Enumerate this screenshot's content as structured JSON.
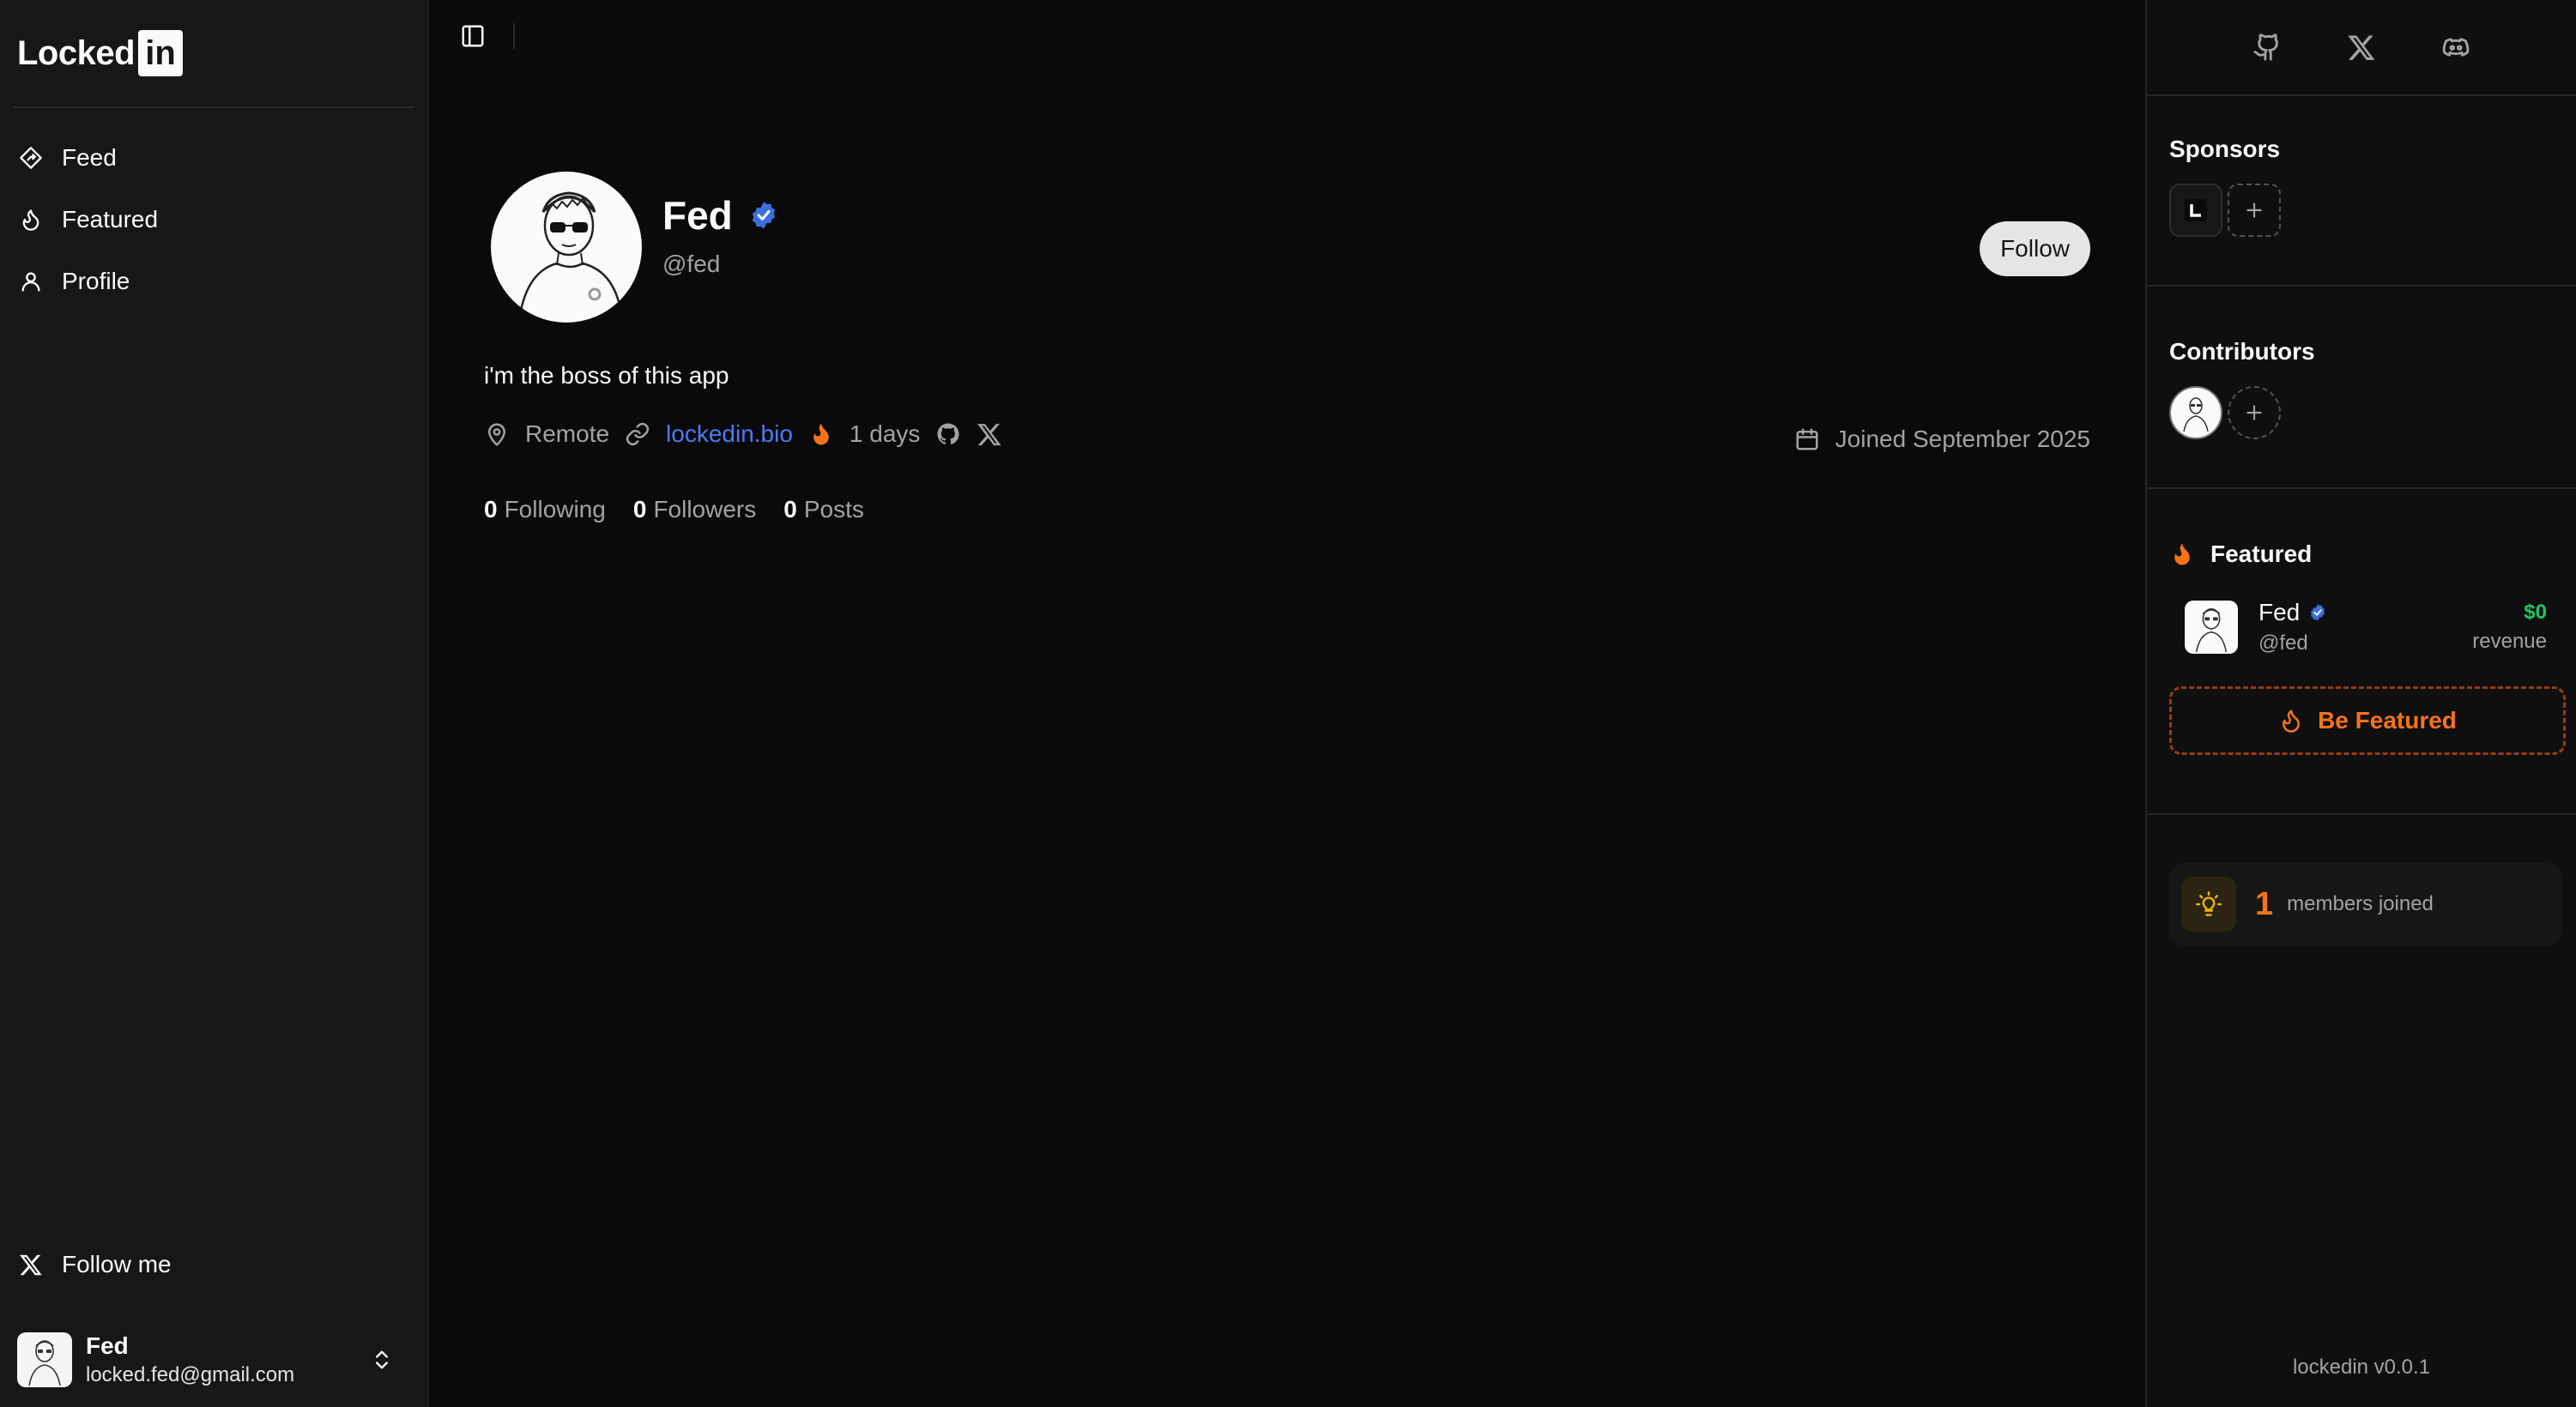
{
  "brand": {
    "text": "Locked",
    "box": "in"
  },
  "nav": {
    "items": [
      {
        "label": "Feed",
        "icon": "feed-icon"
      },
      {
        "label": "Featured",
        "icon": "flame-icon"
      },
      {
        "label": "Profile",
        "icon": "user-icon"
      }
    ],
    "follow_me": "Follow me"
  },
  "current_user": {
    "name": "Fed",
    "email": "locked.fed@gmail.com"
  },
  "profile": {
    "name": "Fed",
    "handle": "@fed",
    "follow_label": "Follow",
    "bio": "i'm the boss of this app",
    "location": "Remote",
    "link": "lockedin.bio",
    "streak": "1 days",
    "joined": "Joined September 2025",
    "stats": [
      {
        "count": "0",
        "label": "Following"
      },
      {
        "count": "0",
        "label": "Followers"
      },
      {
        "count": "0",
        "label": "Posts"
      }
    ]
  },
  "right_panel": {
    "sponsors_title": "Sponsors",
    "contributors_title": "Contributors",
    "featured_title": "Featured",
    "featured_user": {
      "name": "Fed",
      "handle": "@fed",
      "amount": "$0",
      "amount_label": "revenue"
    },
    "be_featured_label": "Be Featured",
    "members_count": "1",
    "members_label": "members joined",
    "version": "lockedin v0.0.1"
  },
  "colors": {
    "accent": "#f97316",
    "link": "#4b7bf5",
    "verified": "#3b6fe0",
    "revenue": "#22c55e"
  }
}
